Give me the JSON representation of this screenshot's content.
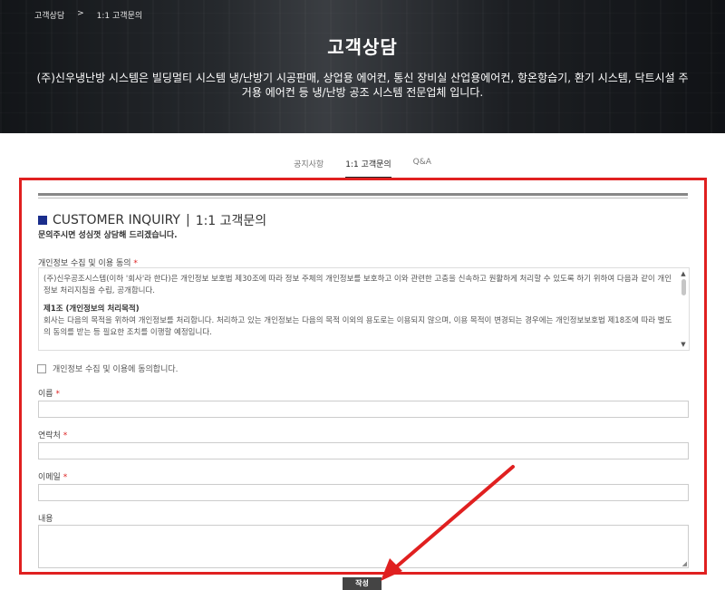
{
  "breadcrumb": {
    "home": "고객상담",
    "sep": ">",
    "current": "1:1 고객문의"
  },
  "hero": {
    "title": "고객상담",
    "description": "(주)신우냉난방 시스템은 빌딩멀티 시스템 냉/난방기 시공판매, 상업용 에어컨, 통신 장비실 산업용에어컨, 항온항습기, 환기 시스템, 닥트시설 주거용 에어컨 등 냉/난방 공조 시스템 전문업체 입니다."
  },
  "tabs": [
    {
      "label": "공지사항",
      "active": false
    },
    {
      "label": "1:1 고객문의",
      "active": true
    },
    {
      "label": "Q&A",
      "active": false
    }
  ],
  "form": {
    "title_en": "CUSTOMER INQUIRY",
    "title_sep": "|",
    "title_ko": "1:1 고객문의",
    "subtitle": "문의주시면 성심껏 상담해 드리겠습니다.",
    "privacy_label": "개인정보 수집 및 이용 동의",
    "required_mark": "*",
    "privacy_text_1": "(주)신우공조시스템(이하 '회사'라 한다)은 개인정보 보호법 제30조에 따라 정보 주체의 개인정보를 보호하고 이와 관련한 고충을 신속하고 원활하게 처리할 수 있도록 하기 위하여 다음과 같이 개인정보 처리지침을 수립, 공개합니다.",
    "privacy_section": "제1조 (개인정보의 처리목적)",
    "privacy_text_2": "회사는 다음의 목적을 위하여 개인정보를 처리합니다. 처리하고 있는 개인정보는 다음의 목적 이외의 용도로는 이용되지 않으며, 이용 목적이 변경되는 경우에는 개인정보보호법 제18조에 따라 별도의 동의를 받는 등 필요한 조치를 이행할 예정입니다.",
    "agree_label": "개인정보 수집 및 이용에 동의합니다.",
    "name_label": "이름",
    "phone_label": "연락처",
    "email_label": "이메일",
    "content_label": "내용",
    "submit_label": "작성"
  },
  "colors": {
    "annotation_red": "#e02020",
    "title_square": "#1a2d8c",
    "submit_bg": "#444444"
  }
}
